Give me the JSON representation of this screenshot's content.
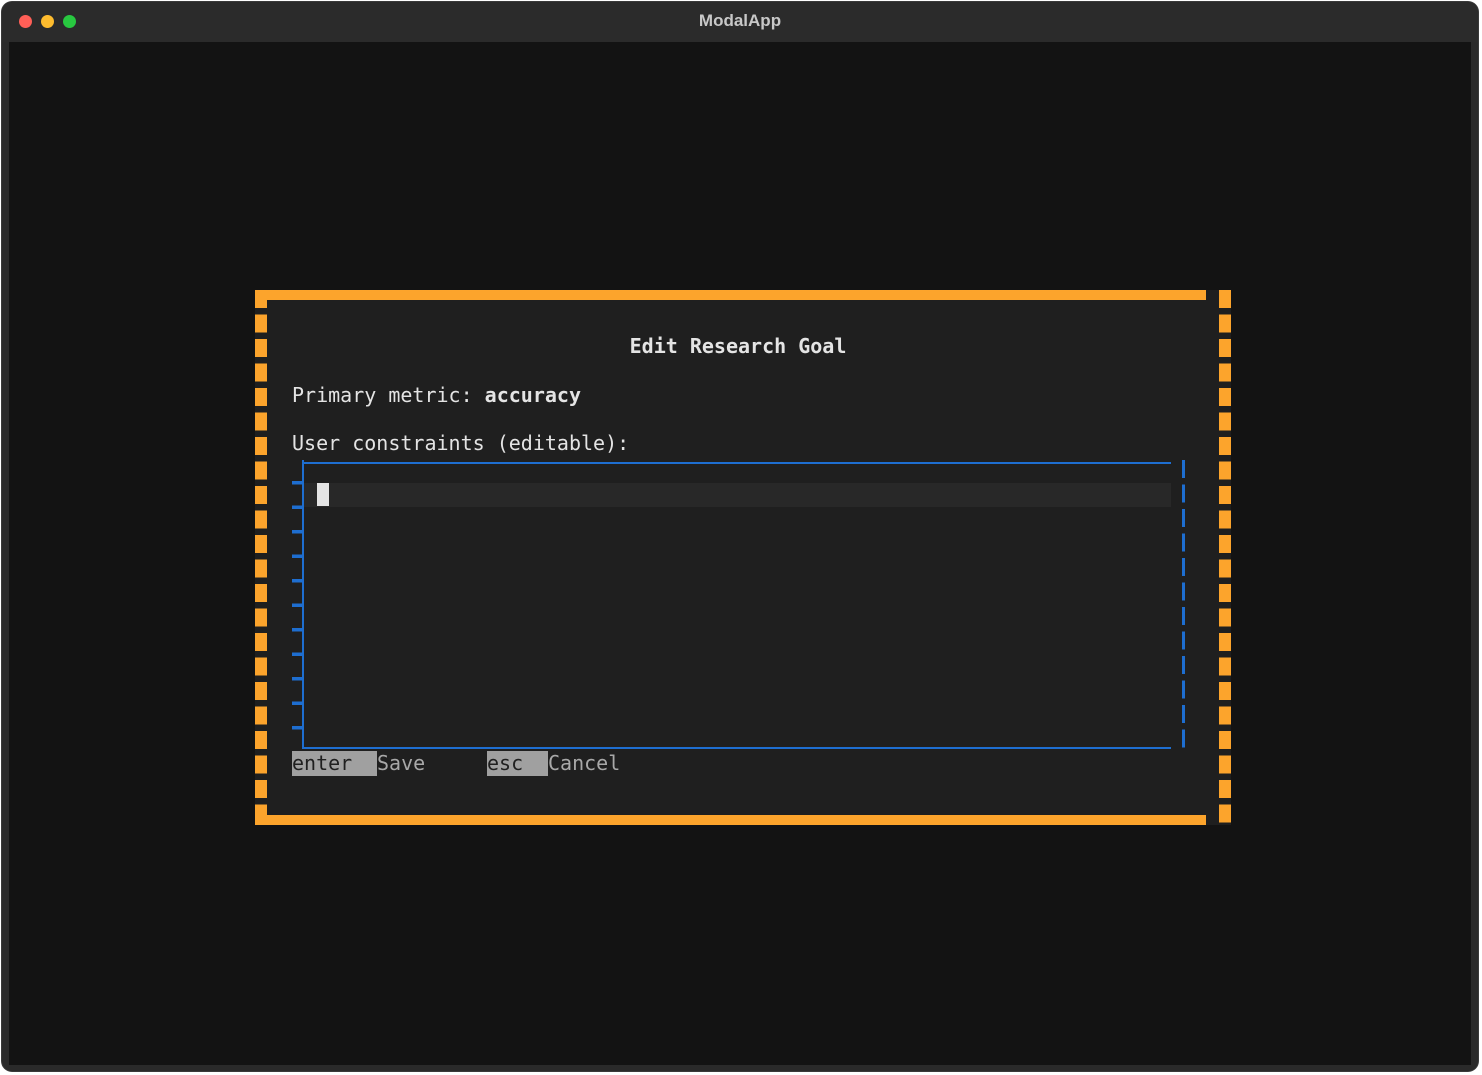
{
  "window": {
    "title": "ModalApp"
  },
  "modal": {
    "title": "Edit Research Goal",
    "primary_metric_label": "Primary metric: ",
    "primary_metric_value": "accuracy",
    "constraints_label": "User constraints (editable):",
    "constraints_value": "",
    "hints": {
      "save_key": "enter ",
      "save_label": "Save",
      "cancel_key": "esc  ",
      "cancel_label": "Cancel"
    }
  },
  "colors": {
    "accent_border": "#fca42c",
    "input_border": "#1e6ed0",
    "terminal_bg": "#131313",
    "modal_bg": "#1f1f1f"
  }
}
